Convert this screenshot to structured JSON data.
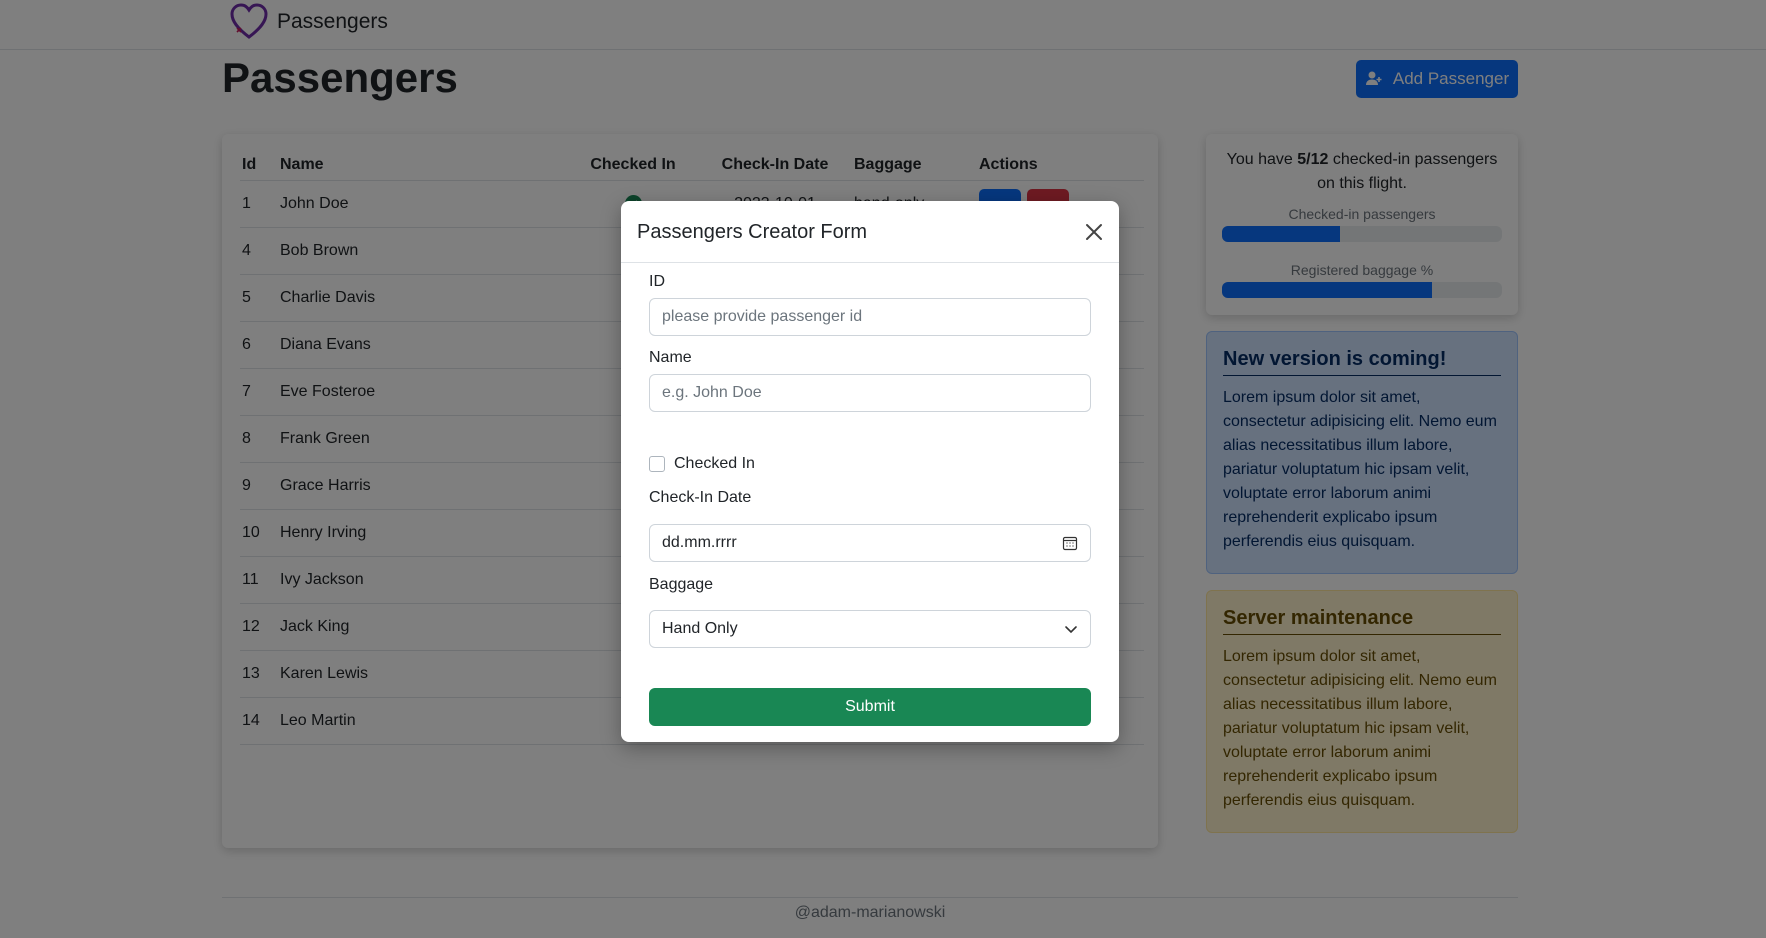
{
  "app": {
    "brand_name": "Passengers",
    "logo_icon": "heart-icon"
  },
  "header": {
    "title": "Passengers",
    "add_button_label": "Add Passenger",
    "add_button_icon": "user-plus-icon"
  },
  "table": {
    "columns": [
      "Id",
      "Name",
      "Checked In",
      "Check-In Date",
      "Baggage",
      "Actions"
    ],
    "rows": [
      {
        "id": "1",
        "name": "John Doe",
        "checked_in": true,
        "date": "2023-10-01",
        "baggage": "hand-only"
      },
      {
        "id": "4",
        "name": "Bob Brown",
        "checked_in": false,
        "date": "",
        "baggage": ""
      },
      {
        "id": "5",
        "name": "Charlie Davis",
        "checked_in": true,
        "date": "",
        "baggage": ""
      },
      {
        "id": "6",
        "name": "Diana Evans",
        "checked_in": false,
        "date": "",
        "baggage": ""
      },
      {
        "id": "7",
        "name": "Eve Fosteroe",
        "checked_in": true,
        "date": "",
        "baggage": ""
      },
      {
        "id": "8",
        "name": "Frank Green",
        "checked_in": false,
        "date": "",
        "baggage": ""
      },
      {
        "id": "9",
        "name": "Grace Harris",
        "checked_in": false,
        "date": "",
        "baggage": ""
      },
      {
        "id": "10",
        "name": "Henry Irving",
        "checked_in": false,
        "date": "",
        "baggage": ""
      },
      {
        "id": "11",
        "name": "Ivy Jackson",
        "checked_in": true,
        "date": "",
        "baggage": ""
      },
      {
        "id": "12",
        "name": "Jack King",
        "checked_in": false,
        "date": "",
        "baggage": ""
      },
      {
        "id": "13",
        "name": "Karen Lewis",
        "checked_in": true,
        "date": "",
        "baggage": ""
      },
      {
        "id": "14",
        "name": "Leo Martin",
        "checked_in": false,
        "date": "",
        "baggage": ""
      }
    ]
  },
  "stats": {
    "text_prefix": "You have ",
    "count": "5/12",
    "text_suffix": " checked-in passengers on this flight.",
    "checked_label": "Checked-in passengers",
    "checked_fraction": 0.42,
    "baggage_label": "Registered baggage %",
    "baggage_fraction": 0.75
  },
  "alerts": [
    {
      "title": "New version is coming!",
      "body": "Lorem ipsum dolor sit amet, consectetur adipisicing elit. Nemo eum alias necessitatibus illum labore, pariatur voluptatum hic ipsam velit, voluptate error laborum animi reprehenderit explicabo ipsum perferendis eius quisquam."
    },
    {
      "title": "Server maintenance",
      "body": "Lorem ipsum dolor sit amet, consectetur adipisicing elit. Nemo eum alias necessitatibus illum labore, pariatur voluptatum hic ipsam velit, voluptate error laborum animi reprehenderit explicabo ipsum perferendis eius quisquam."
    }
  ],
  "footer": {
    "text": "@adam-marianowski"
  },
  "modal": {
    "title": "Passengers Creator Form",
    "id_label": "ID",
    "id_placeholder": "please provide passenger id",
    "name_label": "Name",
    "name_placeholder": "e.g. John Doe",
    "checked_label": "Checked In",
    "date_label": "Check-In Date",
    "date_placeholder": "dd.mm.rrrr",
    "baggage_label": "Baggage",
    "baggage_value": "Hand Only",
    "submit_label": "Submit"
  },
  "colors": {
    "primary": "#0d6efd",
    "success": "#198754",
    "danger": "#dc3545",
    "info_bg": "#cfe2ff",
    "warning_bg": "#fff3cd"
  }
}
